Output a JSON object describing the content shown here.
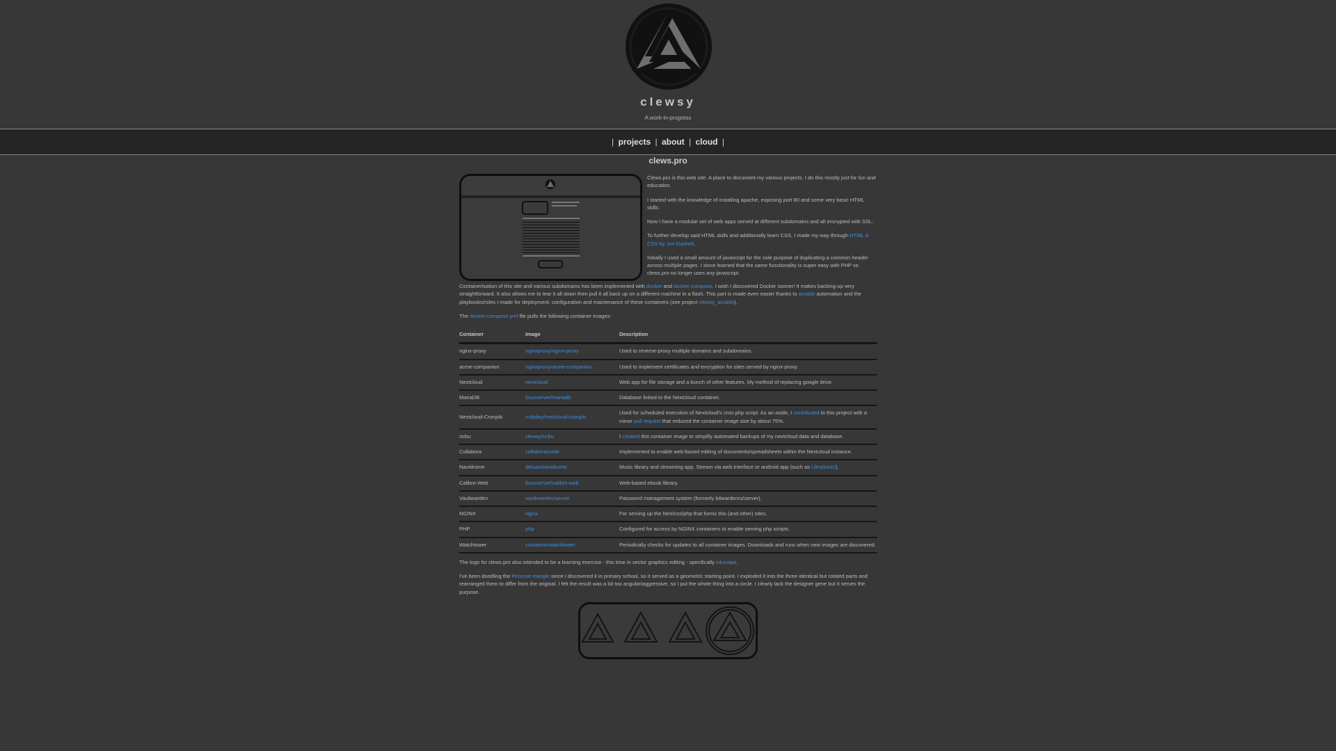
{
  "header": {
    "title": "clewsy",
    "tagline": "A work-in-progress"
  },
  "nav": {
    "items": [
      {
        "label": "projects"
      },
      {
        "label": "about"
      },
      {
        "label": "cloud"
      }
    ],
    "separator": "|"
  },
  "main": {
    "title": "clews.pro",
    "intro_paragraphs": [
      "Clews.pro is this web site. A place to document my various projects. I do this mostly just for fun and education.",
      "I started with the knowledge of installing apache, exposing port 80 and some very basic HTML skills.",
      "Now I have a modular set of web apps served at different subdomains and all encrypted with SSL."
    ],
    "p4": {
      "text": "To further develop said HTML skills and additionally learn CSS, I made my way through",
      "link": "HTML & CSS by Jon Duckett",
      "end": "."
    },
    "p5": "Initially I used a small amount of javascript for the sole purpose of duplicating a common header across multiple pages. I since learned that the same functionality is super easy with PHP so clews.pro no longer uses any javascript.",
    "p6": {
      "t1": "Containerisation of this site and various subdomains has been implemented with",
      "l1": "docker",
      "t2": "and",
      "l2": "docker-compose",
      "t3": ". I wish I discovered Docker sooner! It makes backing-up very straightforward. It also allows me to tear it all down then pull it all back up on a different machine in a flash. This part is made even easier thanks to",
      "l3": "ansible",
      "t4": "automation and the playbooks/roles I made for deployment, configuration and maintenance of these containers (see project",
      "l4": "clewsy_ansible",
      "t5": ")."
    },
    "p7": {
      "t1": "The",
      "l1": "docker-compose.yml",
      "t2": "file pulls the following container images:"
    },
    "p8": {
      "t1": "The logo for clews.pro also intended to be a learning exercise - this time in vector graphics editing - specifically",
      "l1": "inkscape",
      "t2": "."
    },
    "p9": {
      "t1": "I've been doodling the",
      "l1": "Penrose triangle",
      "t2": "since I discovered it in primary school, so it served as a geometric starting point. I exploded it into the three identical but rotated parts and rearranged them to differ from the original. I felt the result was a bit too angular/aggressive, so I put the whole thing into a circle. I clearly lack the designer gene but it serves the purpose."
    }
  },
  "table": {
    "headers": [
      "Container",
      "Image",
      "Description"
    ],
    "rows": [
      {
        "container": "nginx-proxy",
        "image": "nginxproxy/nginx-proxy",
        "desc": "Used to reverse-proxy multiple domains and subdomains."
      },
      {
        "container": "acme-companion",
        "image": "nginxproxy/acme-companion",
        "desc": "Used to implement certificates and encryption for sites served by nginx-proxy."
      },
      {
        "container": "Nextcloud",
        "image": "nextcloud",
        "desc": "Web app for file storage and a bunch of other features. My method of replacing google drive."
      },
      {
        "container": "MariaDB",
        "image": "linuxserver/mariadb",
        "desc": "Database linked to the Nextcloud container."
      },
      {
        "container": "Nextcloud-Cronjob",
        "image": "rcdailey/nextcloud-cronjob",
        "d1": "Used for scheduled execution of Nextcloud's cron.php script. As an aside, I",
        "dl1": "contributed",
        "d2": "to this project with a minor",
        "dl2": "pull request",
        "d3": "that reduced the container image size by about 75%."
      },
      {
        "container": "ncbu",
        "image": "clewsy/ncbu",
        "d1": "I",
        "dl1": "created",
        "d2": "this container image to simplify automated backups of my nextcloud data and database."
      },
      {
        "container": "Collabora",
        "image": "collabora/code",
        "desc": "Implemented to enable web-based editing of documents/spreadsheets within the Nextcloud instance."
      },
      {
        "container": "Navidrome",
        "image": "deluan/navidrome",
        "d1": "Music library and streaming app. Stream via web interface or android app (such as",
        "dl1": "UltraSonic",
        "d2": ")."
      },
      {
        "container": "Calibre-Web",
        "image": "linuxserver/calibre-web",
        "desc": "Web-based ebook library."
      },
      {
        "container": "Vaultwarden",
        "image": "vaultwarden/server",
        "desc": "Password management system (formerly bitwardenrs/server)."
      },
      {
        "container": "NGINX",
        "image": "nginx",
        "desc": "For serving up the html/css/php that forms this (and other) sites."
      },
      {
        "container": "PHP",
        "image": "php",
        "desc": "Configured for access by NGINX containers to enable serving php scripts."
      },
      {
        "container": "Watchtower",
        "image": "containrrr/watchtower",
        "desc": "Periodically checks for updates to all container images. Downloads and runs when new images are discovered."
      }
    ]
  }
}
